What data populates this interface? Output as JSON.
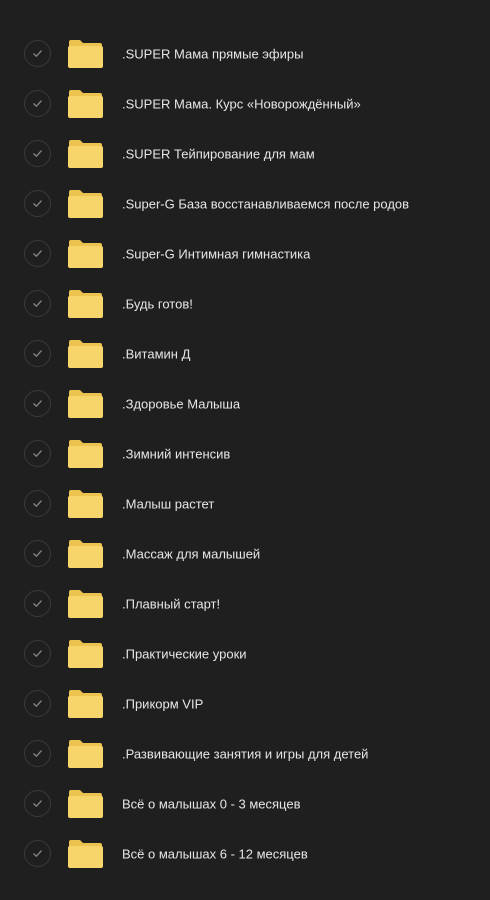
{
  "colors": {
    "background": "#1f1f1f",
    "folder": "#f7d56a",
    "folder_tab": "#edc34f",
    "text": "#e6e6e6",
    "check": "#8a8a8a",
    "check_border": "#3a3a3a"
  },
  "items": [
    {
      "name": ".SUPER Мама прямые эфиры",
      "icon": "folder-icon",
      "checked": true
    },
    {
      "name": ".SUPER Мама. Курс «Новорождённый»",
      "icon": "folder-icon",
      "checked": true
    },
    {
      "name": ".SUPER Тейпирование для мам",
      "icon": "folder-icon",
      "checked": true
    },
    {
      "name": ".Super-G База восстанавливаемся после родов",
      "icon": "folder-icon",
      "checked": true
    },
    {
      "name": ".Super-G Интимная гимнастика",
      "icon": "folder-icon",
      "checked": true
    },
    {
      "name": ".Будь готов!",
      "icon": "folder-icon",
      "checked": true
    },
    {
      "name": ".Витамин Д",
      "icon": "folder-icon",
      "checked": true
    },
    {
      "name": ".Здоровье Малыша",
      "icon": "folder-icon",
      "checked": true
    },
    {
      "name": ".Зимний интенсив",
      "icon": "folder-icon",
      "checked": true
    },
    {
      "name": ".Малыш растет",
      "icon": "folder-icon",
      "checked": true
    },
    {
      "name": ".Массаж для малышей",
      "icon": "folder-icon",
      "checked": true
    },
    {
      "name": ".Плавный старт!",
      "icon": "folder-icon",
      "checked": true
    },
    {
      "name": ".Практические уроки",
      "icon": "folder-icon",
      "checked": true
    },
    {
      "name": ".Прикорм VIP",
      "icon": "folder-icon",
      "checked": true
    },
    {
      "name": ".Развивающие занятия и игры для детей",
      "icon": "folder-icon",
      "checked": true
    },
    {
      "name": "Всё о малышах 0 - 3 месяцев",
      "icon": "folder-icon",
      "checked": true
    },
    {
      "name": "Всё о малышах 6 - 12 месяцев",
      "icon": "folder-icon",
      "checked": true
    }
  ]
}
